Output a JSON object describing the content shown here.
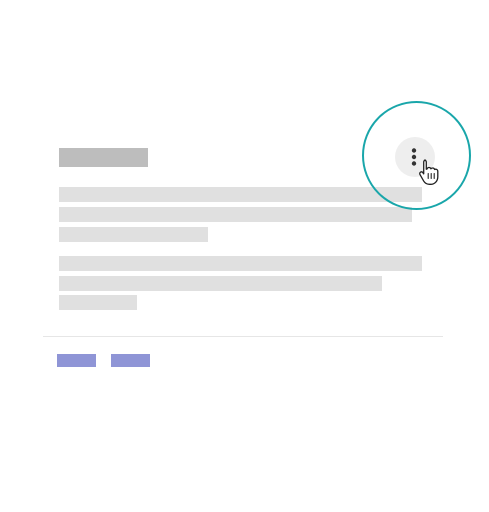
{
  "card": {
    "title_placeholder": "title-skeleton",
    "paragraphs": [
      {
        "lines": 3
      },
      {
        "lines": 3
      }
    ]
  },
  "actions": [
    {
      "name": "action-1"
    },
    {
      "name": "action-2"
    }
  ],
  "colors": {
    "title_skeleton": "#bdbdbd",
    "text_skeleton": "#e0e0e0",
    "action_skeleton": "#8f95d6",
    "highlight_ring": "#19a6aa",
    "more_button_bg": "#eeeeee",
    "more_icon": "#333333"
  },
  "icons": {
    "more": "more-vert-icon",
    "cursor": "hand-pointer-icon"
  }
}
